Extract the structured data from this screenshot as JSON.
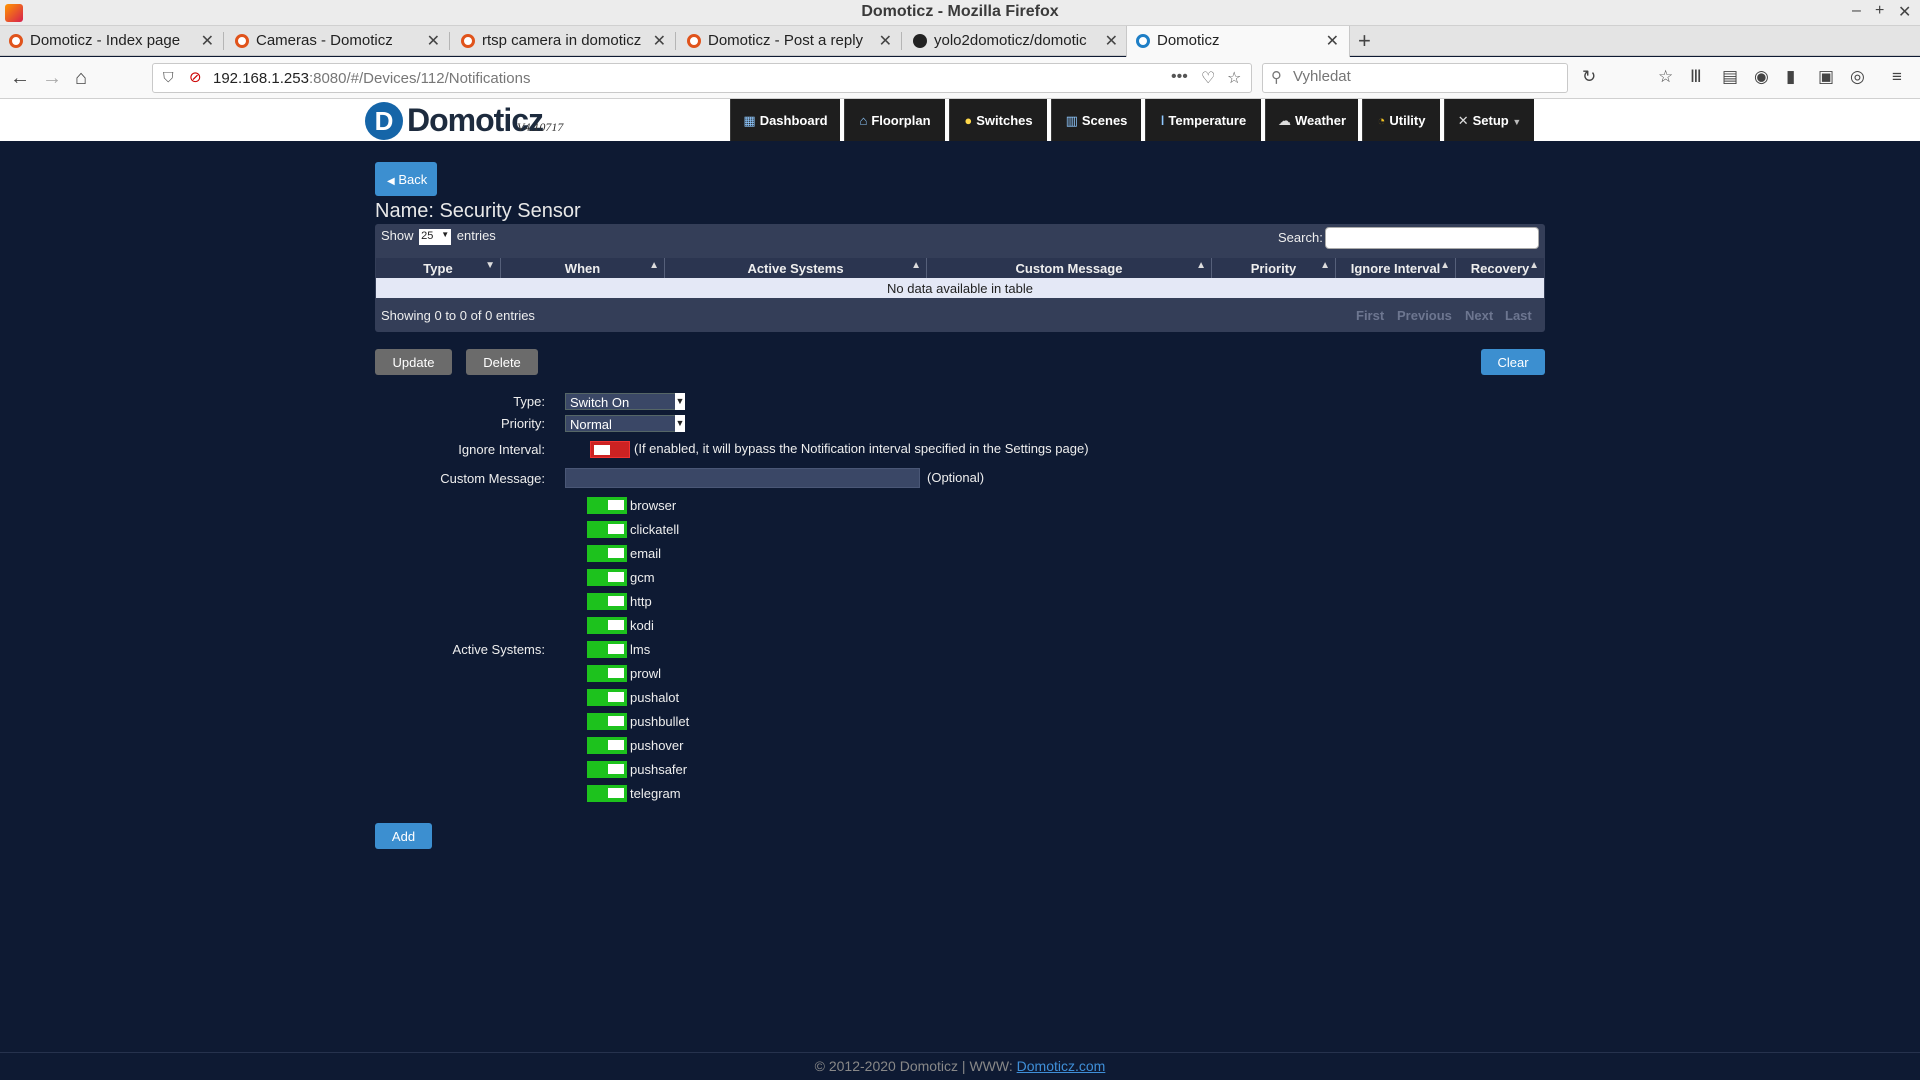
{
  "window": {
    "title": "Domoticz - Mozilla Firefox"
  },
  "tabs": [
    {
      "label": "Domoticz - Index page",
      "icon": "domoticz-forum-icon"
    },
    {
      "label": "Cameras - Domoticz",
      "icon": "domoticz-forum-icon"
    },
    {
      "label": "rtsp camera in domoticz",
      "icon": "domoticz-forum-icon"
    },
    {
      "label": "Domoticz - Post a reply",
      "icon": "domoticz-forum-icon"
    },
    {
      "label": "yolo2domoticz/domotic",
      "icon": "github-icon"
    },
    {
      "label": "Domoticz",
      "icon": "domoticz-icon",
      "active": true
    }
  ],
  "navbar": {
    "url_host": "192.168.1.253",
    "url_rest": ":8080/#/Devices/112/Notifications",
    "search_placeholder": "Vyhledat"
  },
  "app": {
    "logo_text": "Domoticz",
    "version": "V4.10717",
    "menu": [
      {
        "label": "Dashboard",
        "icon": "dashboard-icon"
      },
      {
        "label": "Floorplan",
        "icon": "floorplan-icon"
      },
      {
        "label": "Switches",
        "icon": "lightbulb-icon"
      },
      {
        "label": "Scenes",
        "icon": "scenes-icon"
      },
      {
        "label": "Temperature",
        "icon": "thermometer-icon"
      },
      {
        "label": "Weather",
        "icon": "weather-icon"
      },
      {
        "label": "Utility",
        "icon": "utility-icon"
      },
      {
        "label": "Setup",
        "icon": "tools-icon"
      }
    ]
  },
  "page": {
    "back_label": "Back",
    "device_name": "Name: Security Sensor",
    "table": {
      "show_label": "Show",
      "show_value": "25",
      "entries_label": "entries",
      "search_label": "Search:",
      "columns": [
        "Type",
        "When",
        "Active Systems",
        "Custom Message",
        "Priority",
        "Ignore Interval",
        "Recovery"
      ],
      "empty_text": "No data available in table",
      "info": "Showing 0 to 0 of 0 entries",
      "pagination": [
        "First",
        "Previous",
        "Next",
        "Last"
      ]
    },
    "buttons": {
      "update": "Update",
      "delete": "Delete",
      "clear": "Clear",
      "add": "Add"
    },
    "form": {
      "type_label": "Type:",
      "type_value": "Switch On",
      "priority_label": "Priority:",
      "priority_value": "Normal",
      "ignore_label": "Ignore Interval:",
      "ignore_enabled": false,
      "ignore_note": "(If enabled, it will bypass the Notification interval specified in the Settings page)",
      "custom_label": "Custom Message:",
      "custom_value": "",
      "optional_note": "(Optional)",
      "active_label": "Active Systems:",
      "systems": [
        "browser",
        "clickatell",
        "email",
        "gcm",
        "http",
        "kodi",
        "lms",
        "prowl",
        "pushalot",
        "pushbullet",
        "pushover",
        "pushsafer",
        "telegram"
      ]
    },
    "footer": {
      "text": "© 2012-2020 Domoticz | WWW: ",
      "link": "Domoticz.com"
    }
  },
  "colors": {
    "background": "#0e1a33",
    "accent": "#3c8fd0",
    "toggle_on": "#1dc21d",
    "toggle_off": "#cc2222"
  }
}
